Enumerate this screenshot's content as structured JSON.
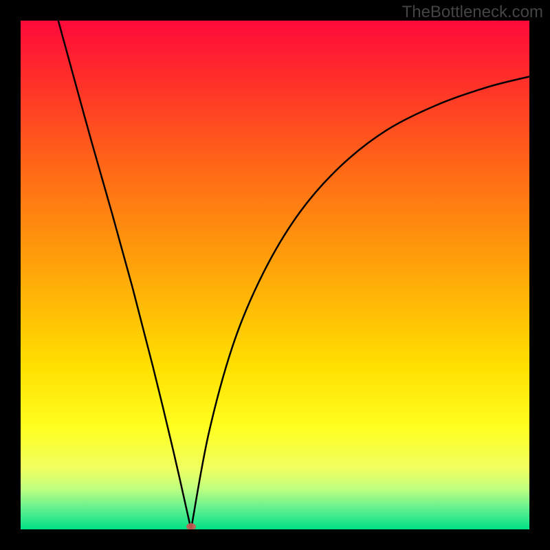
{
  "watermark": "TheBottleneck.com",
  "colors": {
    "background": "#000000",
    "curve": "#000000",
    "marker": "#c95a53",
    "watermark": "#444444"
  },
  "chart_data": {
    "type": "line",
    "title": "",
    "xlabel": "",
    "ylabel": "",
    "xlim": [
      0,
      1
    ],
    "ylim": [
      0,
      1
    ],
    "series": [
      {
        "name": "left-branch",
        "x": [
          0.074,
          0.1,
          0.14,
          0.18,
          0.22,
          0.26,
          0.3,
          0.335
        ],
        "y": [
          1.0,
          0.905,
          0.76,
          0.62,
          0.475,
          0.32,
          0.155,
          0.0
        ]
      },
      {
        "name": "right-branch",
        "x": [
          0.335,
          0.37,
          0.42,
          0.48,
          0.55,
          0.63,
          0.72,
          0.82,
          0.92,
          1.0
        ],
        "y": [
          0.0,
          0.19,
          0.37,
          0.51,
          0.625,
          0.715,
          0.785,
          0.835,
          0.87,
          0.89
        ]
      }
    ],
    "marker": {
      "x": 0.335,
      "y": 0.0
    },
    "gradient_stops": [
      {
        "pos": 0.0,
        "color": "#ff0a3b"
      },
      {
        "pos": 0.5,
        "color": "#ffa808"
      },
      {
        "pos": 0.8,
        "color": "#ffff20"
      },
      {
        "pos": 1.0,
        "color": "#00e084"
      }
    ]
  }
}
